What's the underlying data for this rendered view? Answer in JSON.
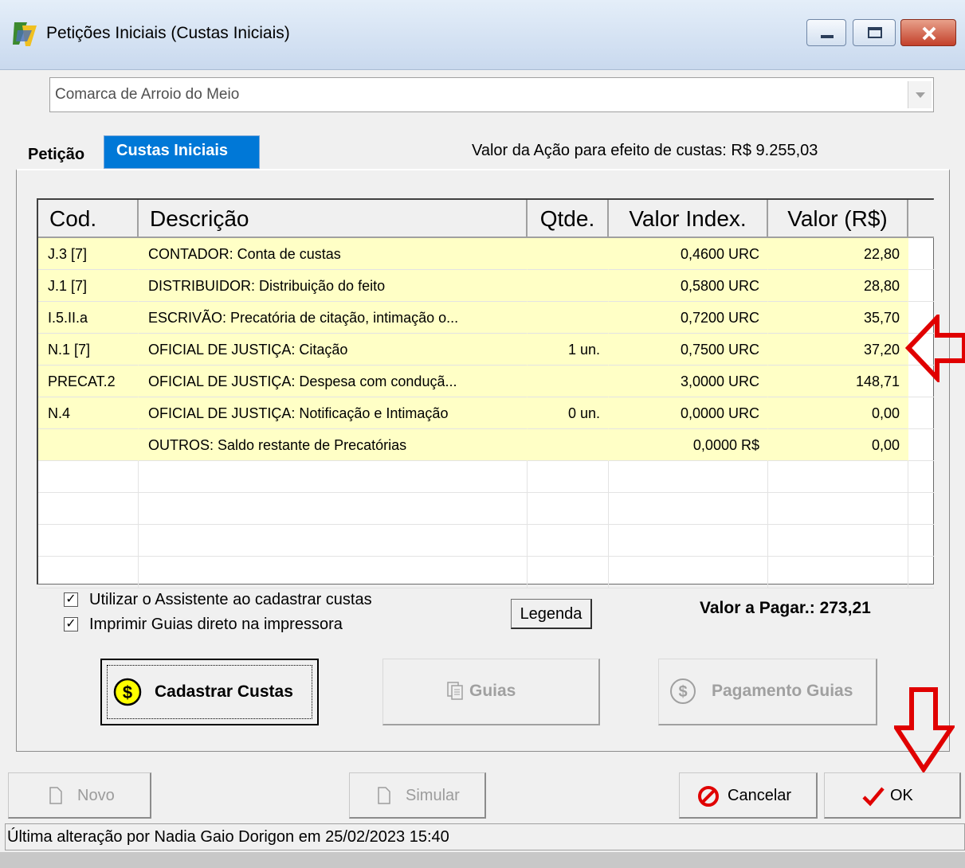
{
  "window": {
    "title": "Petições Iniciais (Custas Iniciais)"
  },
  "comarca": {
    "selected": "Comarca de Arroio do Meio"
  },
  "tabs": [
    {
      "label": "Petição"
    },
    {
      "label": "Custas Iniciais"
    }
  ],
  "valor_acao": "Valor da Ação para efeito de custas: R$ 9.255,03",
  "grid": {
    "headers": [
      "Cod.",
      "Descrição",
      "Qtde.",
      "Valor Index.",
      "Valor (R$)"
    ],
    "rows": [
      {
        "cod": "J.3 [7]",
        "desc": "CONTADOR: Conta de custas",
        "qtde": "",
        "index": "0,4600 URC",
        "valor": "22,80"
      },
      {
        "cod": "J.1 [7]",
        "desc": "DISTRIBUIDOR: Distribuição do feito",
        "qtde": "",
        "index": "0,5800 URC",
        "valor": "28,80"
      },
      {
        "cod": "I.5.II.a",
        "desc": "ESCRIVÃO: Precatória de citação, intimação o...",
        "qtde": "",
        "index": "0,7200 URC",
        "valor": "35,70"
      },
      {
        "cod": "N.1 [7]",
        "desc": "OFICIAL DE JUSTIÇA: Citação",
        "qtde": "1 un.",
        "index": "0,7500 URC",
        "valor": "37,20"
      },
      {
        "cod": "PRECAT.2",
        "desc": "OFICIAL DE JUSTIÇA: Despesa com conduçã...",
        "qtde": "",
        "index": "3,0000 URC",
        "valor": "148,71"
      },
      {
        "cod": "N.4",
        "desc": "OFICIAL DE JUSTIÇA: Notificação e Intimação",
        "qtde": "0 un.",
        "index": "0,0000 URC",
        "valor": "0,00"
      },
      {
        "cod": "",
        "desc": "OUTROS: Saldo restante de Precatórias",
        "qtde": "",
        "index": "0,0000 R$",
        "valor": "0,00"
      }
    ]
  },
  "options": {
    "assistente": {
      "label": "Utilizar o Assistente ao cadastrar custas",
      "checked": true
    },
    "imprimir": {
      "label": "Imprimir Guias direto na impressora",
      "checked": true
    }
  },
  "legenda_label": "Legenda",
  "valor_pagar": "Valor a Pagar.: 273,21",
  "actions": {
    "cadastrar": "Cadastrar Custas",
    "guias": "Guias",
    "pagamento": "Pagamento Guias"
  },
  "bottom": {
    "novo": "Novo",
    "simular": "Simular",
    "cancelar": "Cancelar",
    "ok": "OK"
  },
  "status": "Última alteração por Nadia Gaio Dorigon em 25/02/2023 15:40",
  "colors": {
    "tab_active": "#0078d7",
    "row_highlight": "#ffffc6",
    "annotation_arrow": "#e00000"
  }
}
